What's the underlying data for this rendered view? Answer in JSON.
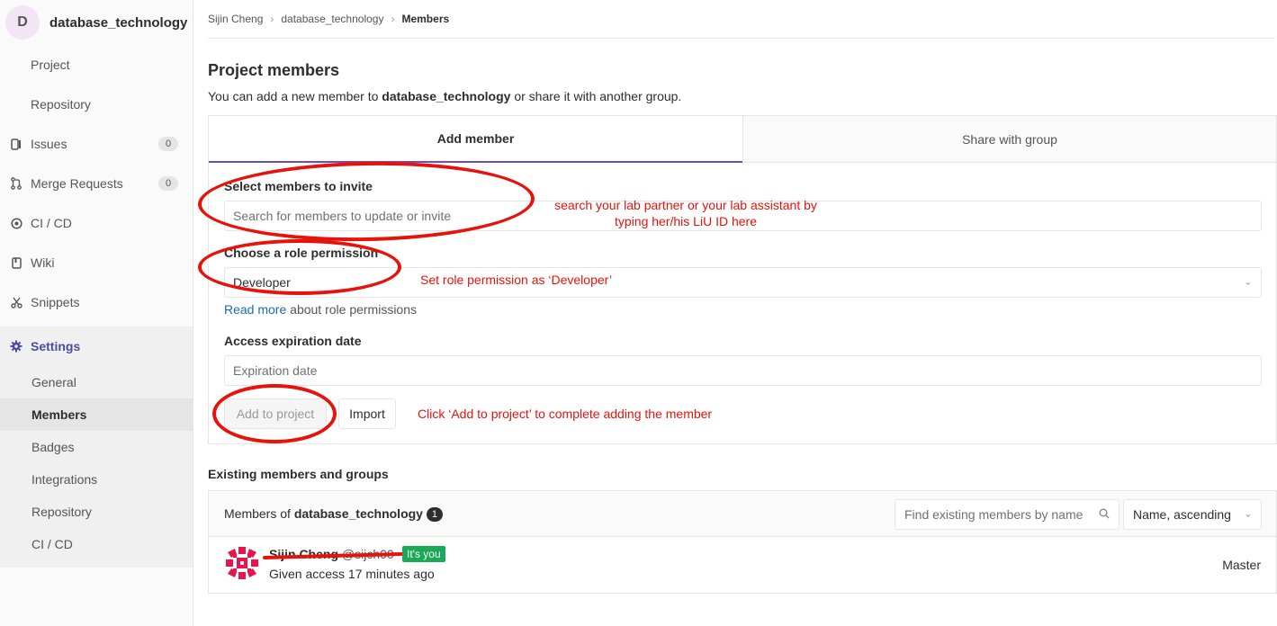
{
  "project": {
    "avatar_letter": "D",
    "name": "database_technology"
  },
  "sidebar": {
    "items": [
      {
        "label": "Project",
        "icon": "home-icon"
      },
      {
        "label": "Repository",
        "icon": "doc-icon"
      },
      {
        "label": "Issues",
        "icon": "issues-icon",
        "count": "0"
      },
      {
        "label": "Merge Requests",
        "icon": "merge-request-icon",
        "count": "0"
      },
      {
        "label": "CI / CD",
        "icon": "rocket-icon"
      },
      {
        "label": "Wiki",
        "icon": "book-icon"
      },
      {
        "label": "Snippets",
        "icon": "scissors-icon"
      },
      {
        "label": "Settings",
        "icon": "gear-icon"
      }
    ],
    "settings_sub": [
      "General",
      "Members",
      "Badges",
      "Integrations",
      "Repository",
      "CI / CD"
    ]
  },
  "breadcrumb": [
    "Sijin Cheng",
    "database_technology",
    "Members"
  ],
  "page": {
    "title": "Project members",
    "desc_prefix": "You can add a new member to ",
    "desc_project": "database_technology",
    "desc_suffix": " or share it with another group."
  },
  "tabs": [
    "Add member",
    "Share with group"
  ],
  "form": {
    "invite_label": "Select members to invite",
    "invite_placeholder": "Search for members to update or invite",
    "role_label": "Choose a role permission",
    "role_value": "Developer",
    "read_more": "Read more",
    "read_more_suffix": " about role permissions",
    "expiration_label": "Access expiration date",
    "expiration_placeholder": "Expiration date",
    "add_button": "Add to project",
    "import_button": "Import"
  },
  "annotations": {
    "search_line1": "search your lab partner or your lab assistant by",
    "search_line2": "typing her/his LiU ID here",
    "role": "Set role permission as ‘Developer’",
    "add": "Click ‘Add to project’ to complete adding the member"
  },
  "existing": {
    "title": "Existing members and groups",
    "members_of_prefix": "Members of ",
    "members_of_project": "database_technology",
    "count": "1",
    "search_placeholder": "Find existing members by name",
    "sort_value": "Name, ascending",
    "member": {
      "name": "Sijin Cheng",
      "username": "@sijch00",
      "its_you": "It's you",
      "given": "Given access 17 minutes ago",
      "role": "Master"
    }
  },
  "colors": {
    "annotation": "#e8120b",
    "accent": "#6b4fbb",
    "link": "#1b69b6",
    "its_you": "#1aaa55"
  }
}
